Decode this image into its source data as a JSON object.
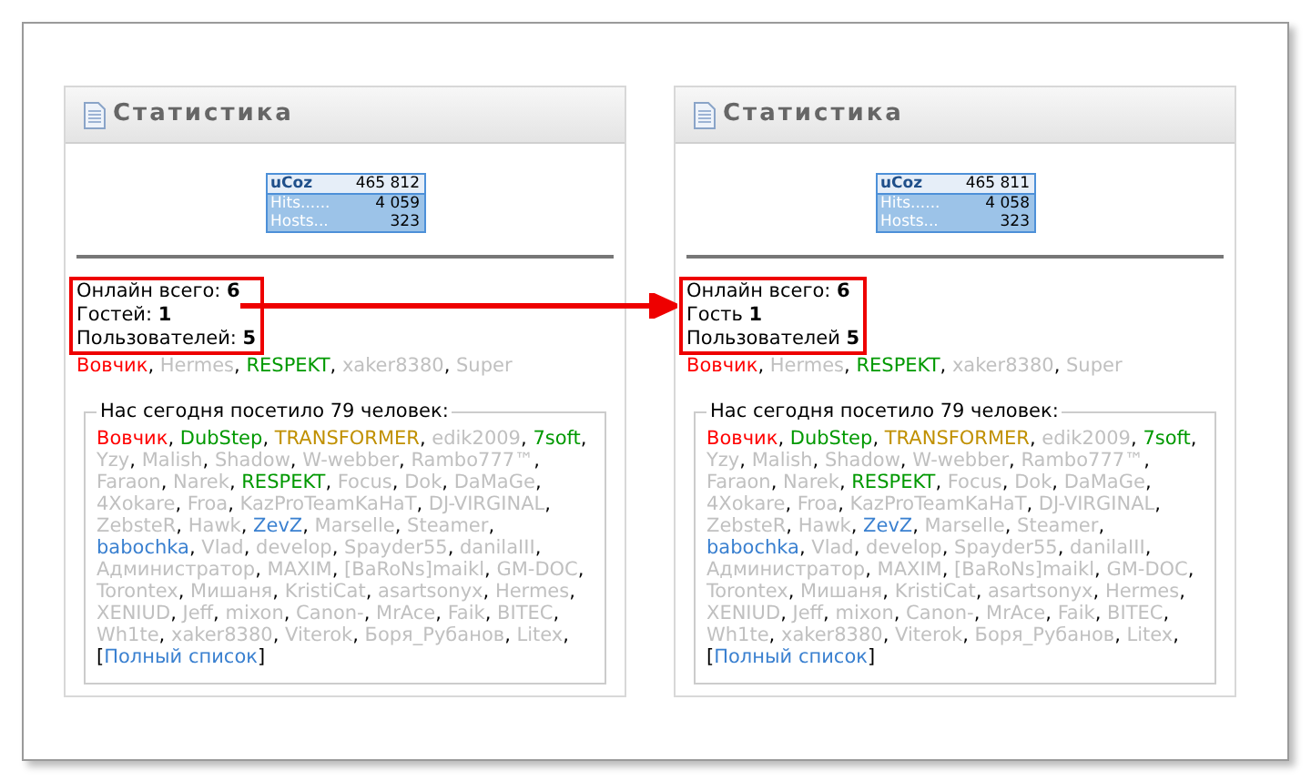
{
  "panels": [
    {
      "title": "Статистика",
      "counter": {
        "logo": "uCoz",
        "total": "465 812",
        "rows": [
          {
            "label": "Hits......",
            "value": "4 059"
          },
          {
            "label": "Hosts...",
            "value": "323"
          }
        ]
      },
      "online": [
        "Онлайн всего: **6**",
        "Гостей: **1**",
        "Пользователей: **5**"
      ],
      "online_users": [
        {
          "name": "Вовчик",
          "color": "#ff0000"
        },
        {
          "name": "Hermes",
          "color": "#c0c0c0"
        },
        {
          "name": "RESPEKT",
          "color": "#009900"
        },
        {
          "name": "xaker8380",
          "color": "#c0c0c0"
        },
        {
          "name": "Super",
          "color": "#c0c0c0"
        }
      ],
      "visitors_title": "Нас сегодня посетило 79 человек:",
      "visitors": [
        {
          "name": "Вовчик",
          "color": "#ff0000"
        },
        {
          "name": "DubStep",
          "color": "#009900"
        },
        {
          "name": "TRANSFORMER",
          "color": "#c09000"
        },
        {
          "name": "edik2009",
          "color": "#c0c0c0"
        },
        {
          "name": "7soft",
          "color": "#009900"
        },
        {
          "name": "Yzy",
          "color": "#c0c0c0"
        },
        {
          "name": "Malish",
          "color": "#c0c0c0"
        },
        {
          "name": "Shadow",
          "color": "#c0c0c0"
        },
        {
          "name": "W-webber",
          "color": "#c0c0c0"
        },
        {
          "name": "Rambo777™",
          "color": "#c0c0c0"
        },
        {
          "name": "Faraon",
          "color": "#c0c0c0"
        },
        {
          "name": "Narek",
          "color": "#c0c0c0"
        },
        {
          "name": "RESPEKT",
          "color": "#009900"
        },
        {
          "name": "Focus",
          "color": "#c0c0c0"
        },
        {
          "name": "Dok",
          "color": "#c0c0c0"
        },
        {
          "name": "DaMaGe",
          "color": "#c0c0c0"
        },
        {
          "name": "4Xokare",
          "color": "#c0c0c0"
        },
        {
          "name": "Froa",
          "color": "#c0c0c0"
        },
        {
          "name": "KazProTeamKaHaT",
          "color": "#c0c0c0"
        },
        {
          "name": "DJ-VIRGINAL",
          "color": "#c0c0c0"
        },
        {
          "name": "ZebsteR",
          "color": "#c0c0c0"
        },
        {
          "name": "Hawk",
          "color": "#c0c0c0"
        },
        {
          "name": "ZevZ",
          "color": "#3a80d0"
        },
        {
          "name": "Marselle",
          "color": "#c0c0c0"
        },
        {
          "name": "Steamer",
          "color": "#c0c0c0"
        },
        {
          "name": "babochka",
          "color": "#3a80d0"
        },
        {
          "name": "Vlad",
          "color": "#c0c0c0"
        },
        {
          "name": "develop",
          "color": "#c0c0c0"
        },
        {
          "name": "Spayder55",
          "color": "#c0c0c0"
        },
        {
          "name": "danilaIII",
          "color": "#c0c0c0"
        },
        {
          "name": "Администратор",
          "color": "#c0c0c0"
        },
        {
          "name": "MAXIM",
          "color": "#c0c0c0"
        },
        {
          "name": "[BaRoNs]maikl",
          "color": "#c0c0c0"
        },
        {
          "name": "GM-DOC",
          "color": "#c0c0c0"
        },
        {
          "name": "Torontex",
          "color": "#c0c0c0"
        },
        {
          "name": "Мишаня",
          "color": "#c0c0c0"
        },
        {
          "name": "KristiCat",
          "color": "#c0c0c0"
        },
        {
          "name": "asartsonyx",
          "color": "#c0c0c0"
        },
        {
          "name": "Hermes",
          "color": "#c0c0c0"
        },
        {
          "name": "XENIUD",
          "color": "#c0c0c0"
        },
        {
          "name": "Jeff",
          "color": "#c0c0c0"
        },
        {
          "name": "mixon",
          "color": "#c0c0c0"
        },
        {
          "name": "Canon-",
          "color": "#c0c0c0"
        },
        {
          "name": "MrAce",
          "color": "#c0c0c0"
        },
        {
          "name": "Faik",
          "color": "#c0c0c0"
        },
        {
          "name": "BITEC",
          "color": "#c0c0c0"
        },
        {
          "name": "Wh1te",
          "color": "#c0c0c0"
        },
        {
          "name": "xaker8380",
          "color": "#c0c0c0"
        },
        {
          "name": "Viterok",
          "color": "#c0c0c0"
        },
        {
          "name": "Боря_Рубанов",
          "color": "#c0c0c0"
        },
        {
          "name": "Litex",
          "color": "#c0c0c0"
        }
      ],
      "full_list": "Полный список"
    },
    {
      "title": "Статистика",
      "counter": {
        "logo": "uCoz",
        "total": "465 811",
        "rows": [
          {
            "label": "Hits......",
            "value": "4 058"
          },
          {
            "label": "Hosts...",
            "value": "323"
          }
        ]
      },
      "online": [
        "Онлайн всего: **6**",
        "Гость **1**",
        "Пользователей **5**"
      ],
      "online_users": [
        {
          "name": "Вовчик",
          "color": "#ff0000"
        },
        {
          "name": "Hermes",
          "color": "#c0c0c0"
        },
        {
          "name": "RESPEKT",
          "color": "#009900"
        },
        {
          "name": "xaker8380",
          "color": "#c0c0c0"
        },
        {
          "name": "Super",
          "color": "#c0c0c0"
        }
      ],
      "visitors_title": "Нас сегодня посетило 79 человек:",
      "visitors": [
        {
          "name": "Вовчик",
          "color": "#ff0000"
        },
        {
          "name": "DubStep",
          "color": "#009900"
        },
        {
          "name": "TRANSFORMER",
          "color": "#c09000"
        },
        {
          "name": "edik2009",
          "color": "#c0c0c0"
        },
        {
          "name": "7soft",
          "color": "#009900"
        },
        {
          "name": "Yzy",
          "color": "#c0c0c0"
        },
        {
          "name": "Malish",
          "color": "#c0c0c0"
        },
        {
          "name": "Shadow",
          "color": "#c0c0c0"
        },
        {
          "name": "W-webber",
          "color": "#c0c0c0"
        },
        {
          "name": "Rambo777™",
          "color": "#c0c0c0"
        },
        {
          "name": "Faraon",
          "color": "#c0c0c0"
        },
        {
          "name": "Narek",
          "color": "#c0c0c0"
        },
        {
          "name": "RESPEKT",
          "color": "#009900"
        },
        {
          "name": "Focus",
          "color": "#c0c0c0"
        },
        {
          "name": "Dok",
          "color": "#c0c0c0"
        },
        {
          "name": "DaMaGe",
          "color": "#c0c0c0"
        },
        {
          "name": "4Xokare",
          "color": "#c0c0c0"
        },
        {
          "name": "Froa",
          "color": "#c0c0c0"
        },
        {
          "name": "KazProTeamKaHaT",
          "color": "#c0c0c0"
        },
        {
          "name": "DJ-VIRGINAL",
          "color": "#c0c0c0"
        },
        {
          "name": "ZebsteR",
          "color": "#c0c0c0"
        },
        {
          "name": "Hawk",
          "color": "#c0c0c0"
        },
        {
          "name": "ZevZ",
          "color": "#3a80d0"
        },
        {
          "name": "Marselle",
          "color": "#c0c0c0"
        },
        {
          "name": "Steamer",
          "color": "#c0c0c0"
        },
        {
          "name": "babochka",
          "color": "#3a80d0"
        },
        {
          "name": "Vlad",
          "color": "#c0c0c0"
        },
        {
          "name": "develop",
          "color": "#c0c0c0"
        },
        {
          "name": "Spayder55",
          "color": "#c0c0c0"
        },
        {
          "name": "danilaIII",
          "color": "#c0c0c0"
        },
        {
          "name": "Администратор",
          "color": "#c0c0c0"
        },
        {
          "name": "MAXIM",
          "color": "#c0c0c0"
        },
        {
          "name": "[BaRoNs]maikl",
          "color": "#c0c0c0"
        },
        {
          "name": "GM-DOC",
          "color": "#c0c0c0"
        },
        {
          "name": "Torontex",
          "color": "#c0c0c0"
        },
        {
          "name": "Мишаня",
          "color": "#c0c0c0"
        },
        {
          "name": "KristiCat",
          "color": "#c0c0c0"
        },
        {
          "name": "asartsonyx",
          "color": "#c0c0c0"
        },
        {
          "name": "Hermes",
          "color": "#c0c0c0"
        },
        {
          "name": "XENIUD",
          "color": "#c0c0c0"
        },
        {
          "name": "Jeff",
          "color": "#c0c0c0"
        },
        {
          "name": "mixon",
          "color": "#c0c0c0"
        },
        {
          "name": "Canon-",
          "color": "#c0c0c0"
        },
        {
          "name": "MrAce",
          "color": "#c0c0c0"
        },
        {
          "name": "Faik",
          "color": "#c0c0c0"
        },
        {
          "name": "BITEC",
          "color": "#c0c0c0"
        },
        {
          "name": "Wh1te",
          "color": "#c0c0c0"
        },
        {
          "name": "xaker8380",
          "color": "#c0c0c0"
        },
        {
          "name": "Viterok",
          "color": "#c0c0c0"
        },
        {
          "name": "Боря_Рубанов",
          "color": "#c0c0c0"
        },
        {
          "name": "Litex",
          "color": "#c0c0c0"
        }
      ],
      "full_list": "Полный список"
    }
  ],
  "separator": ", ",
  "brackets": [
    "[",
    "]"
  ]
}
